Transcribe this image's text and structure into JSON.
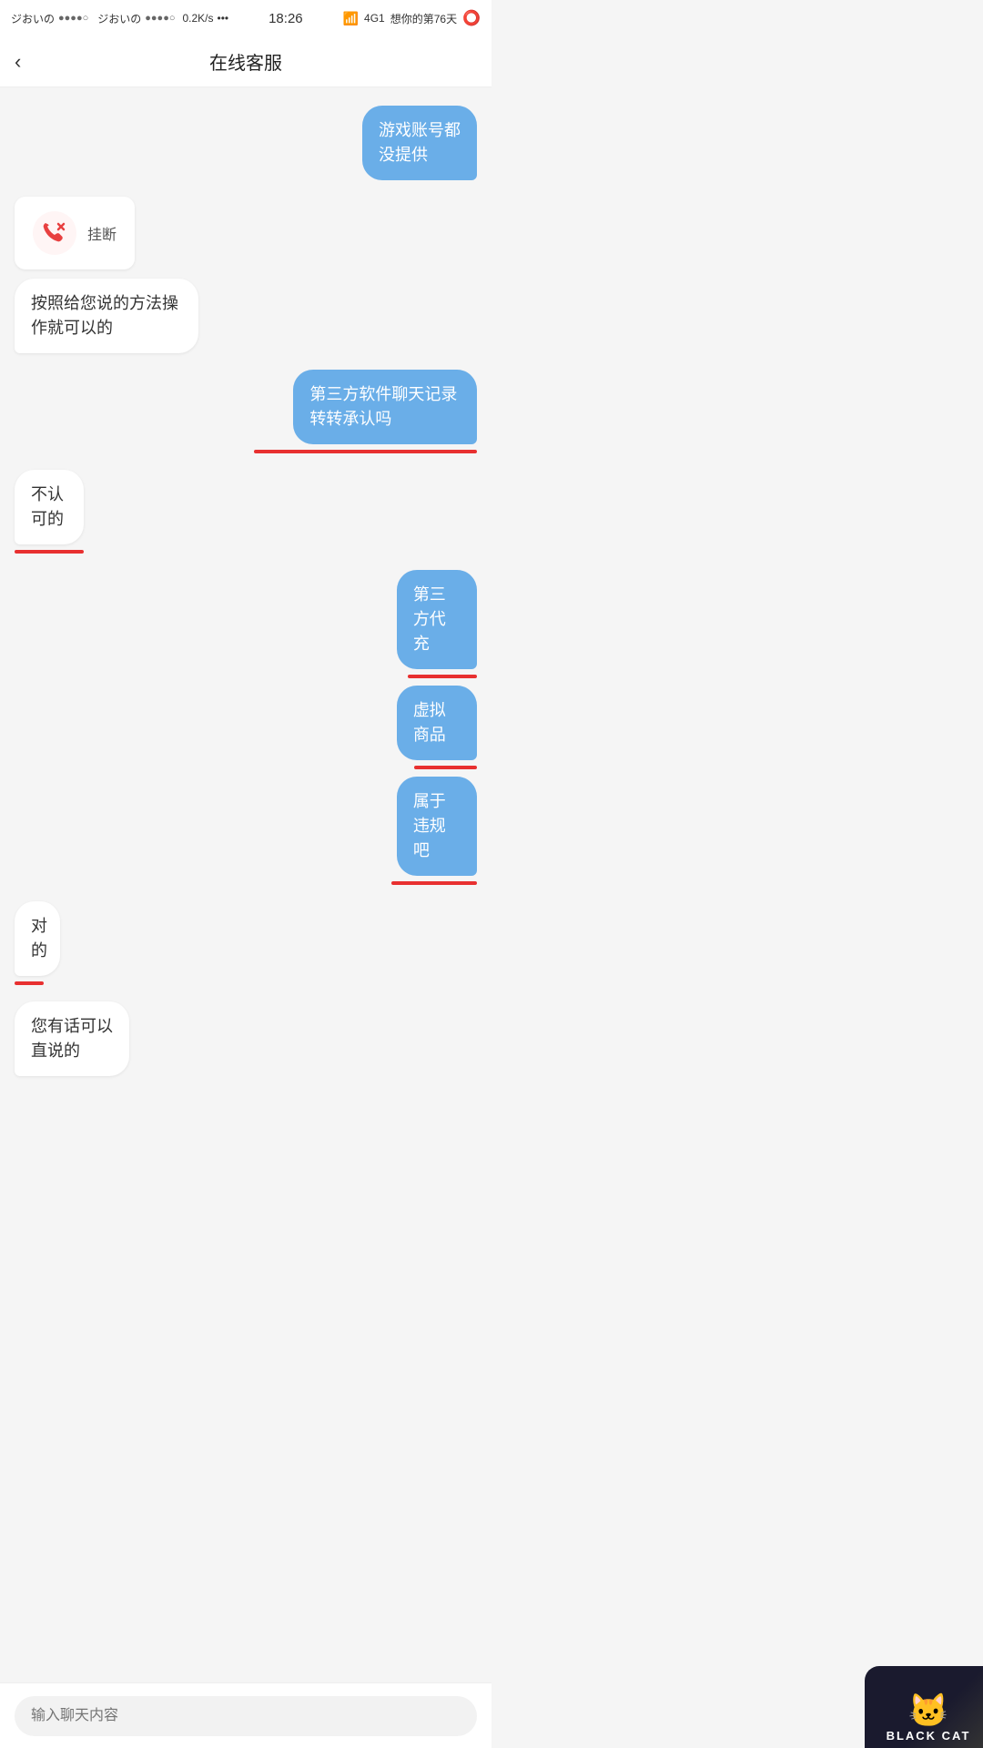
{
  "statusBar": {
    "left1": "ジおいの",
    "dots1": "●●●●○",
    "left2": "ジおいの",
    "dots2": "●●●●○",
    "speed": "0.2K/s",
    "dots3": "•••",
    "time": "18:26",
    "network": "4G1",
    "greeting": "想你的第76天"
  },
  "header": {
    "title": "在线客服",
    "back": "‹"
  },
  "messages": [
    {
      "type": "user",
      "text": "游戏账号都没提供",
      "redline": false
    },
    {
      "type": "agent-call",
      "label": "挂断",
      "subtext": "按照给您说的方法操作就可以的",
      "redline": false
    },
    {
      "type": "user",
      "text": "第三方软件聊天记录转转承认吗",
      "redline": true
    },
    {
      "type": "agent",
      "text": "不认可的",
      "redline": true
    },
    {
      "type": "user-stack",
      "items": [
        "第三方代充",
        "虚拟商品",
        "属于违规吧"
      ],
      "redlines": [
        true,
        true,
        true
      ]
    },
    {
      "type": "agent",
      "text": "对的",
      "redline": true
    },
    {
      "type": "agent",
      "text": "您有话可以直说的",
      "redline": false
    }
  ],
  "input": {
    "placeholder": "输入聊天内容"
  },
  "watermark": {
    "icon": "🐱",
    "text": "BLACK CAT"
  }
}
